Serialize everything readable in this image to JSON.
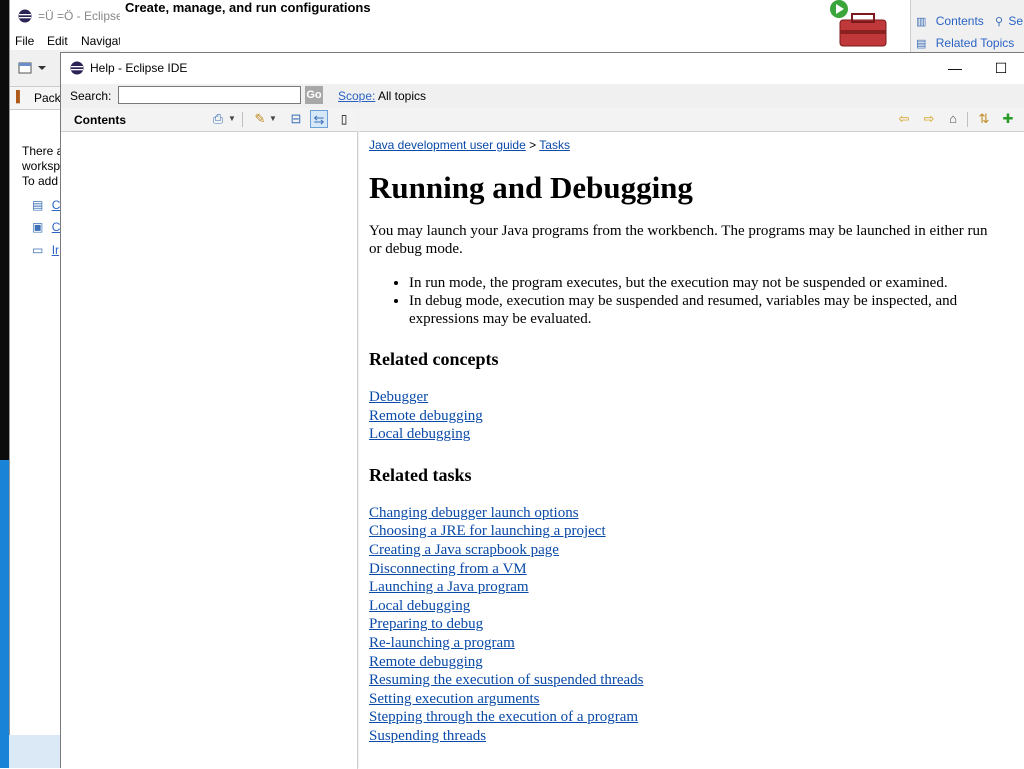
{
  "background_window": {
    "title": "=Ü =Ö - Eclipse",
    "menu": [
      "File",
      "Edit",
      "Navigat"
    ],
    "pack_tab": "Pack",
    "body_text": [
      "There a",
      "worksp",
      "To add"
    ],
    "links": [
      "C",
      "C",
      "Ir"
    ]
  },
  "launch_dialog": {
    "message": "Create, manage, and run configurations"
  },
  "right_view": {
    "contents": "Contents",
    "search": "Se",
    "related_topics": "Related Topics"
  },
  "help_window": {
    "title": "Help - Eclipse IDE",
    "minimize": "—",
    "maximize": "☐",
    "search_label": "Search:",
    "search_value": "",
    "go_label": "Go",
    "scope_link": "Scope:",
    "scope_value": "All topics",
    "contents_title": "Contents"
  },
  "document": {
    "breadcrumb": [
      "Java development user guide",
      "Tasks"
    ],
    "breadcrumb_sep": ">",
    "title": "Running and Debugging",
    "intro_line1": "You may launch your Java programs from the workbench.  The programs may be launched in either run",
    "intro_line2": "or debug mode.",
    "bullets": [
      "In run mode, the program executes, but the execution may not be suspended or examined.",
      "In debug mode, execution may be suspended and resumed, variables may be inspected, and expressions may be evaluated."
    ],
    "related_concepts_heading": "Related concepts",
    "related_concepts": [
      "Debugger",
      "Remote debugging",
      "Local debugging"
    ],
    "related_tasks_heading": "Related tasks",
    "related_tasks": [
      "Changing debugger launch options",
      "Choosing a JRE for launching a project",
      "Creating a Java scrapbook page",
      "Disconnecting from a VM",
      "Launching a Java program",
      "Local debugging",
      "Preparing to debug",
      "Re-launching a program",
      "Remote debugging",
      "Resuming the execution of suspended threads",
      "Setting execution arguments",
      "Stepping through the execution of a program",
      "Suspending threads"
    ]
  },
  "colors": {
    "link": "#0a4aa8",
    "accent": "#2b63c4",
    "desktop": "#1883d7"
  }
}
